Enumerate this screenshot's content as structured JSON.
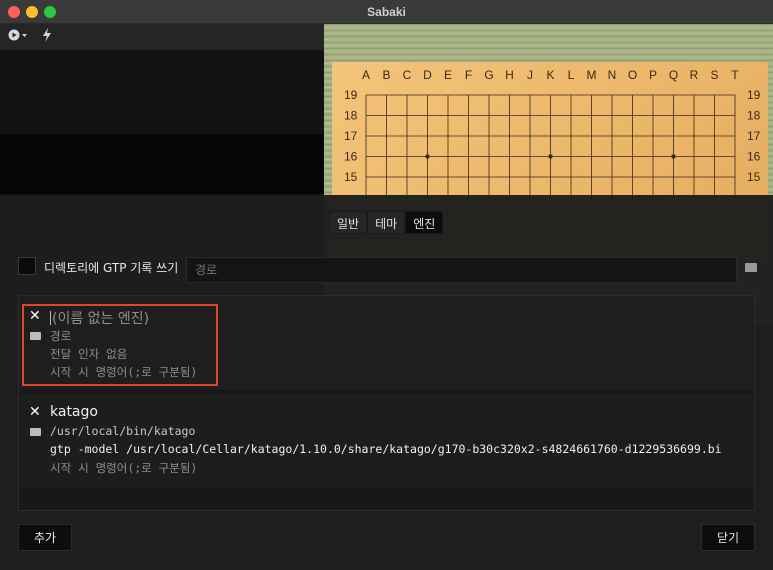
{
  "window": {
    "title": "Sabaki"
  },
  "toolbar": {
    "play_icon": "play-circle-icon",
    "autoplay_icon": "lightning-icon"
  },
  "board": {
    "columns": [
      "A",
      "B",
      "C",
      "D",
      "E",
      "F",
      "G",
      "H",
      "J",
      "K",
      "L",
      "M",
      "N",
      "O",
      "P",
      "Q",
      "R",
      "S",
      "T"
    ],
    "rows": [
      "19",
      "18",
      "17",
      "16",
      "15"
    ]
  },
  "tabs": [
    {
      "label": "일반",
      "active": false
    },
    {
      "label": "테마",
      "active": false
    },
    {
      "label": "엔진",
      "active": true
    }
  ],
  "gtp": {
    "label": "디렉토리에 GTP 기록 쓰기",
    "placeholder": "경로",
    "checked": false
  },
  "engines": [
    {
      "name": "",
      "name_placeholder": "(이름 없는 엔진)",
      "path": "",
      "path_placeholder": "경로",
      "args": "",
      "args_placeholder": "전달 인자 없음",
      "commands": "",
      "commands_placeholder": "시작 시 명령어(;로 구분됨)"
    },
    {
      "name": "katago",
      "name_placeholder": "(이름 없는 엔진)",
      "path": "/usr/local/bin/katago",
      "path_placeholder": "경로",
      "args": "gtp -model /usr/local/Cellar/katago/1.10.0/share/katago/g170-b30c320x2-s4824661760-d1229536699.bi",
      "args_placeholder": "전달 인자 없음",
      "commands": "",
      "commands_placeholder": "시작 시 명령어(;로 구분됨)"
    }
  ],
  "buttons": {
    "add": "추가",
    "close": "닫기"
  },
  "colors": {
    "highlight": "#e0452b",
    "board": "#e8b46a"
  }
}
